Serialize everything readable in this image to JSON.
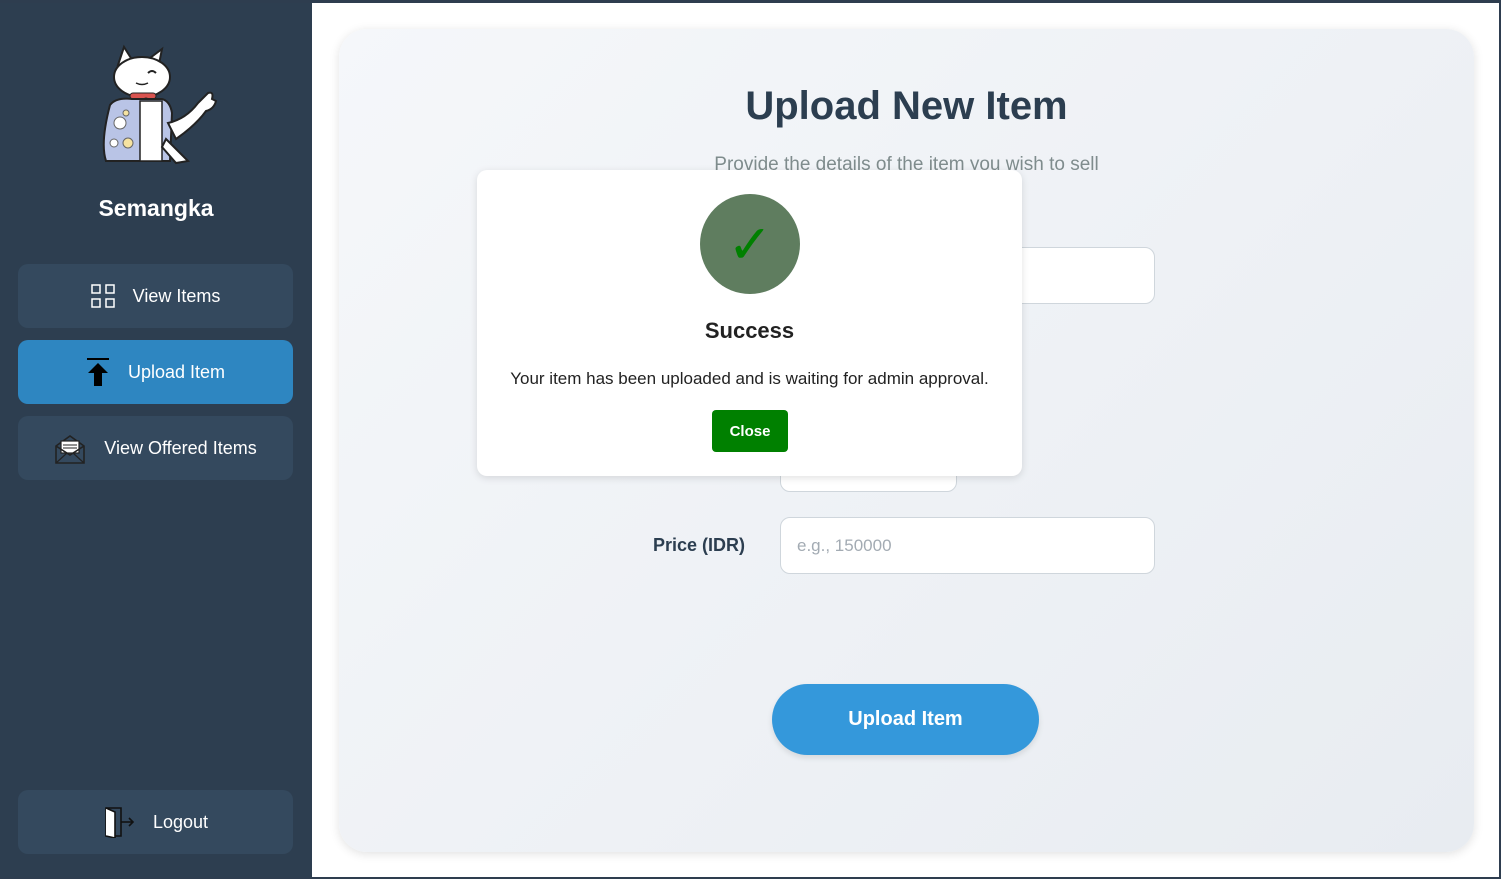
{
  "sidebar": {
    "user_name": "Semangka",
    "avatar_icon": "cat-mascot-avatar",
    "items": [
      {
        "label": "View Items",
        "icon": "grid-icon"
      },
      {
        "label": "Upload Item",
        "icon": "upload-arrow-icon",
        "active": true
      },
      {
        "label": "View Offered Items",
        "icon": "offer-envelope-icon"
      }
    ],
    "logout_label": "Logout",
    "logout_icon": "logout-door-icon"
  },
  "main": {
    "title": "Upload New Item",
    "subtitle": "Provide the details of the item you wish to sell",
    "price_label": "Price (IDR)",
    "price_placeholder": "e.g., 150000",
    "submit_label": "Upload Item"
  },
  "modal": {
    "icon": "check-mark-icon",
    "check_glyph": "✓",
    "title": "Success",
    "message": "Your item has been uploaded and is waiting for admin approval.",
    "close_label": "Close"
  },
  "colors": {
    "sidebar_bg": "#2d3e50",
    "nav_bg": "#34495e",
    "nav_active": "#2e86c1",
    "primary_button": "#3498db",
    "success_green": "#008000",
    "success_circle": "#5f7d5f"
  }
}
